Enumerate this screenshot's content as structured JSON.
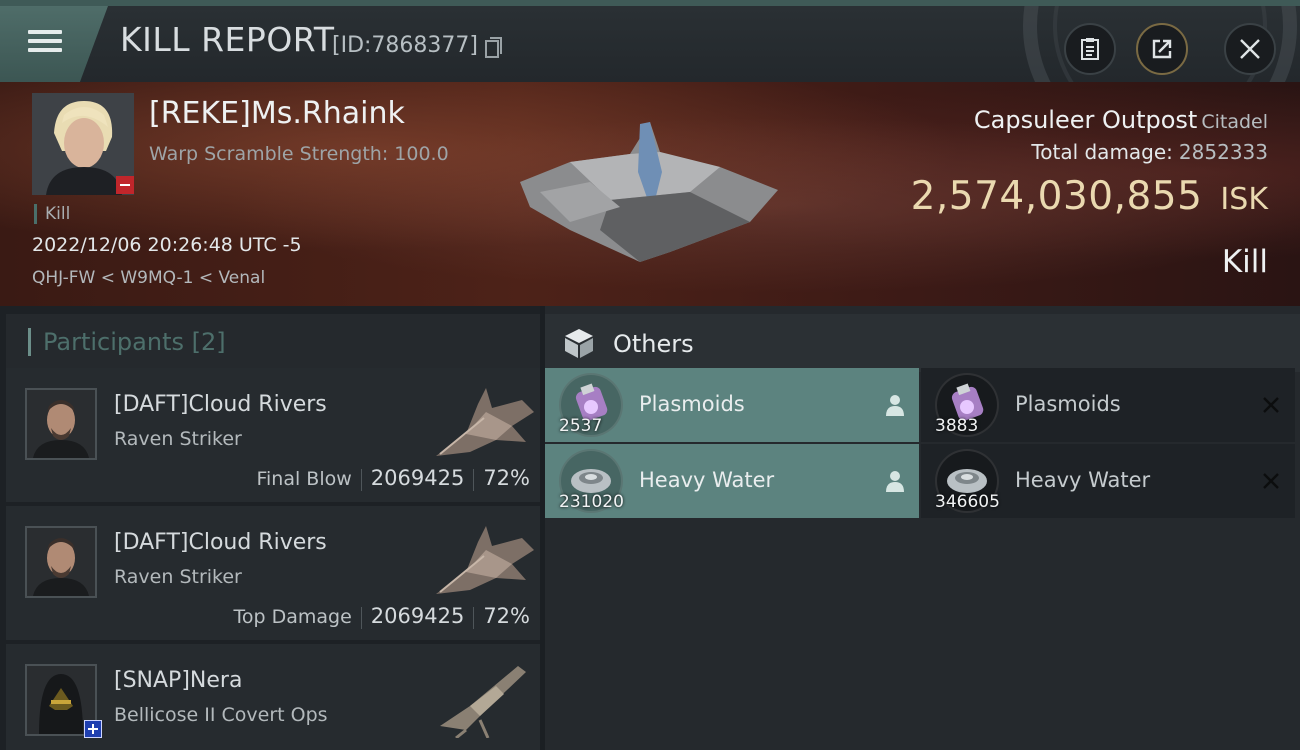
{
  "window": {
    "title": "KILL REPORT",
    "report_id": "[ID:7868377]",
    "icons": [
      "menu-icon",
      "copy-icon",
      "clipboard-icon",
      "share-icon",
      "close-icon"
    ]
  },
  "victim": {
    "name": "[REKE]Ms.Rhaink",
    "scramble": "Warp Scramble Strength: 100.0",
    "kill_tag": "Kill",
    "timestamp": "2022/12/06 20:26:48 UTC -5",
    "location": "QHJ-FW < W9MQ-1 < Venal",
    "security_color": "#c0262b"
  },
  "target": {
    "name": "Capsuleer Outpost",
    "type": "Citadel",
    "damage_label": "Total damage:",
    "damage_value": "2852333",
    "isk_value": "2,574,030,855",
    "isk_unit": "ISK",
    "result": "Kill"
  },
  "participants": {
    "title": "Participants",
    "count": "[2]",
    "items": [
      {
        "name": "[DAFT]Cloud Rivers",
        "ship": "Raven Striker",
        "tag": "Final Blow",
        "damage": "2069425",
        "percent": "72%"
      },
      {
        "name": "[DAFT]Cloud Rivers",
        "ship": "Raven Striker",
        "tag": "Top Damage",
        "damage": "2069425",
        "percent": "72%"
      },
      {
        "name": "[SNAP]Nera",
        "ship": "Bellicose II Covert Ops"
      }
    ]
  },
  "others": {
    "title": "Others",
    "items": [
      {
        "name": "Plasmoids",
        "qty": "2537",
        "state": "dropped"
      },
      {
        "name": "Plasmoids",
        "qty": "3883",
        "state": "destroyed"
      },
      {
        "name": "Heavy Water",
        "qty": "231020",
        "state": "dropped"
      },
      {
        "name": "Heavy Water",
        "qty": "346605",
        "state": "destroyed"
      }
    ]
  },
  "colors": {
    "accent_teal": "#5c837f",
    "isk_gold": "#ead9b0"
  }
}
